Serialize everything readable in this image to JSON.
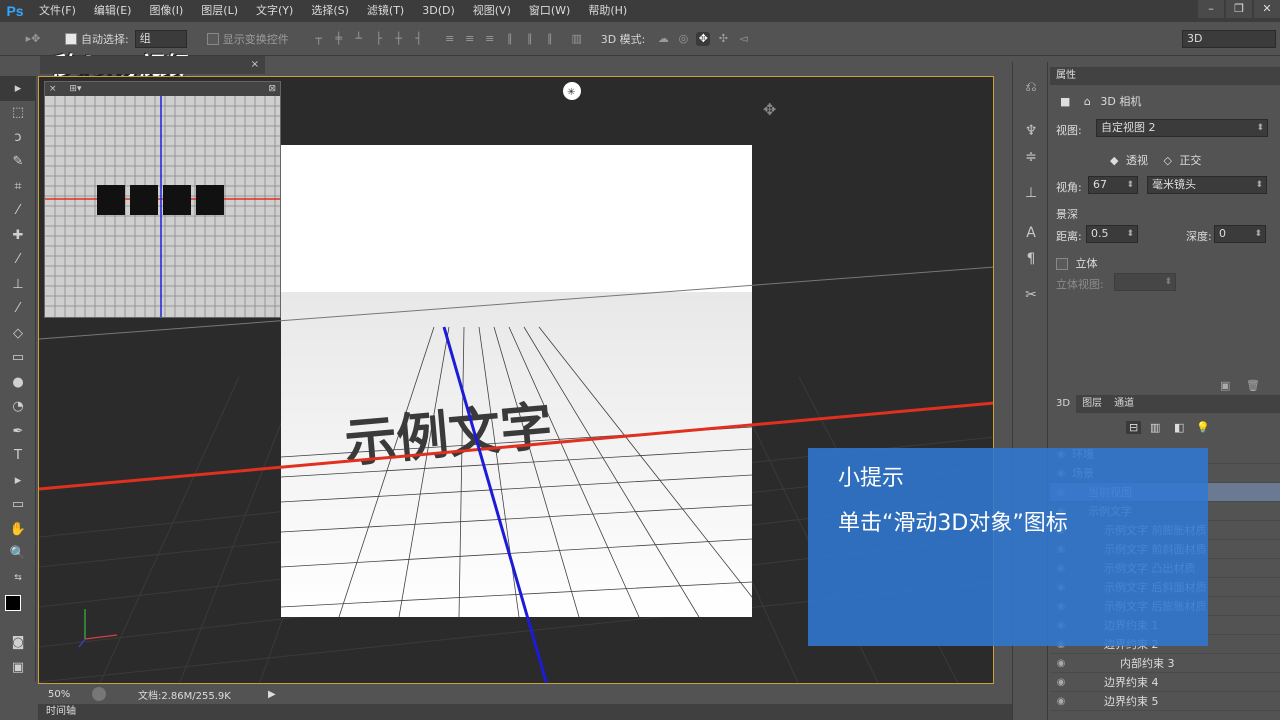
{
  "menubar": {
    "logo": "Ps",
    "items": [
      "文件(F)",
      "编辑(E)",
      "图像(I)",
      "图层(L)",
      "文字(Y)",
      "选择(S)",
      "滤镜(T)",
      "3D(D)",
      "视图(V)",
      "窗口(W)",
      "帮助(H)"
    ]
  },
  "options": {
    "auto_select_label": "自动选择:",
    "auto_select_value": "组",
    "show_transform_label": "显示变换控件",
    "mode_3d_label": "3D 模式:",
    "workspace": "3D"
  },
  "brand": "秒dong视频",
  "canvas": {
    "sample_text": "示例文字"
  },
  "status": {
    "zoom": "50%",
    "doc_info": "文档:2.86M/255.9K"
  },
  "timeline_label": "时间轴",
  "properties": {
    "tab_label": "属性",
    "camera_label": "3D 相机",
    "view_label": "视图:",
    "view_value": "自定视图 2",
    "perspective_label": "透视",
    "ortho_label": "正交",
    "fov_label": "视角:",
    "fov_value": "67",
    "lens_value": "毫米镜头",
    "dof_label": "景深",
    "distance_label": "距离:",
    "distance_value": "0.5",
    "depth_label": "深度:",
    "depth_value": "0",
    "stereo_label": "立体",
    "stereo_view_label": "立体视图:"
  },
  "layers_panel": {
    "tabs": [
      "3D",
      "图层",
      "通道"
    ],
    "rows": [
      {
        "label": "环境",
        "indent": 0
      },
      {
        "label": "场景",
        "indent": 0
      },
      {
        "label": "当前视图",
        "indent": 1
      },
      {
        "label": "示例文字",
        "indent": 1
      },
      {
        "label": "示例文字  前膨胀材质",
        "indent": 2
      },
      {
        "label": "示例文字  前斜面材质",
        "indent": 2
      },
      {
        "label": "示例文字  凸出材质",
        "indent": 2
      },
      {
        "label": "示例文字  后斜面材质",
        "indent": 2
      },
      {
        "label": "示例文字  后膨胀材质",
        "indent": 2
      },
      {
        "label": "边界约束 1",
        "indent": 2
      },
      {
        "label": "边界约束 2",
        "indent": 2
      },
      {
        "label": "内部约束 3",
        "indent": 3
      },
      {
        "label": "边界约束 4",
        "indent": 2
      },
      {
        "label": "边界约束 5",
        "indent": 2
      }
    ]
  },
  "tip": {
    "title": "小提示",
    "body": "单击“滑动3D对象”图标"
  },
  "colors": {
    "accent_blue": "#3078d2",
    "canvas_border": "#c8a13a",
    "x_axis": "#e03020",
    "z_axis": "#2020e0"
  }
}
